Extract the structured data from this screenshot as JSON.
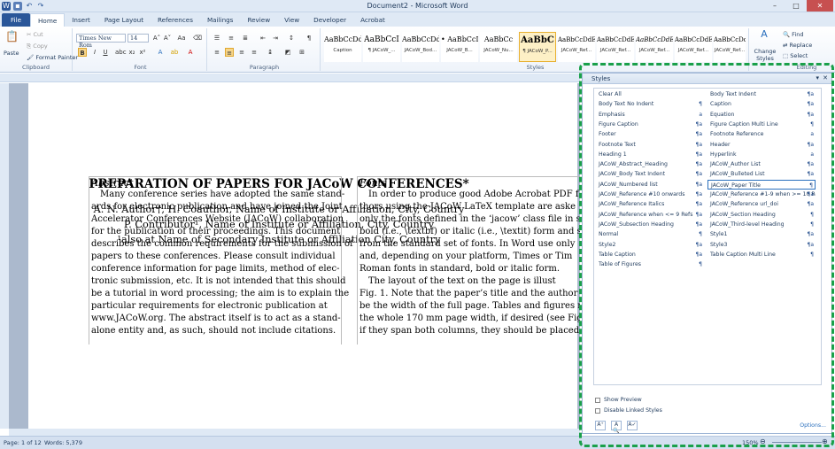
{
  "window": {
    "title": "Document2 - Microsoft Word",
    "qat_icons": [
      "word-icon",
      "save-icon",
      "undo-icon",
      "redo-icon"
    ]
  },
  "tabs": [
    "File",
    "Home",
    "Insert",
    "Page Layout",
    "References",
    "Mailings",
    "Review",
    "View",
    "Developer",
    "Acrobat"
  ],
  "ribbon": {
    "clipboard": {
      "label": "Clipboard",
      "paste": "Paste",
      "cut": "Cut",
      "copy": "Copy",
      "format_painter": "Format Painter"
    },
    "font": {
      "label": "Font",
      "font_name": "Times New Rom",
      "font_size": "14"
    },
    "paragraph": {
      "label": "Paragraph"
    },
    "styles": {
      "label": "Styles",
      "gallery": [
        {
          "preview": "AaBbCcDd",
          "name": "Caption"
        },
        {
          "preview": "AaBbCcI",
          "name": "¶ JACoW_..."
        },
        {
          "preview": "AaBbCcDd",
          "name": "JACoW_Bod..."
        },
        {
          "preview": "• AaBbCcI",
          "name": "JACoW_B..."
        },
        {
          "preview": "AaBbCc",
          "name": "JACoW_Nu..."
        },
        {
          "preview": "AaBbC",
          "name": "¶ JACoW_P..."
        },
        {
          "preview": "AaBbCcDdE",
          "name": "JACoW_Ref..."
        },
        {
          "preview": "AaBbCcDdE",
          "name": "JACoW_Ref..."
        },
        {
          "preview": "AaBbCcDdE",
          "name": "JACoW_Ref..."
        },
        {
          "preview": "AaBbCcDdE",
          "name": "JACoW_Ref..."
        },
        {
          "preview": "AaBbCcDdE",
          "name": "JACoW_Ref..."
        }
      ],
      "change_styles": "Change Styles"
    },
    "editing": {
      "label": "Editing",
      "find": "Find",
      "replace": "Replace",
      "select": "Select"
    }
  },
  "document": {
    "title": "PREPARATION OF PAPERS FOR JACoW CONFERENCES*",
    "authors": [
      "A. N. Author†, H. Coauthor, Name of Institute or Affiliation, City, Country",
      "P. Contributor¹, Name of Institute or Affiliation, City, Country",
      "¹also at Name of Secondary Institute or Affiliation City, Country"
    ],
    "abstract_heading": "Abstract",
    "abstract_lines": [
      "Many conference series have adopted the same stand-",
      "ards for electronic publication and have joined the Joint",
      "Accelerator Conferences Website (JACoW) collaboration",
      "for the publication of their proceedings. This document",
      "describes the common requirements for the submission of",
      "papers to these conferences. Please consult individual",
      "conference information for page limits, method of elec-",
      "tronic submission, etc. It is not intended that this should",
      "be a tutorial in word processing; the aim is to explain the",
      "particular requirements for electronic publication at",
      "www.JACoW.org. The abstract itself is to act as a stand-",
      "alone entity and, as such, should not include citations."
    ],
    "fonts_heading": "Fonts",
    "fonts_lines": [
      "In order to produce good Adobe Acrobat PDF f",
      "thors using the JACoW LaTeX template are aske",
      "only the fonts defined in the ‘jacow’ class file in s",
      "bold (i.e., \\textbf) or italic (i.e., \\textit) form and s",
      "from the standard set of fonts. In Word use only",
      "and, depending on your platform, Times or Tim",
      "Roman fonts in standard, bold or italic form.",
      "The layout of the text on the page is illust",
      "Fig. 1. Note that the paper’s title and the author lis",
      "be the width of the full page. Tables and figures m",
      "the whole 170 mm page width, if desired (see Fig",
      "if they span both columns, they should be placed"
    ]
  },
  "status": {
    "page": "Page: 1 of 12",
    "words": "Words: 5,379",
    "zoom": "150%"
  },
  "styles_panel": {
    "title": "Styles",
    "items_left": [
      {
        "name": "Clear All",
        "mark": ""
      },
      {
        "name": "Body Text No Indent",
        "mark": "¶"
      },
      {
        "name": "Emphasis",
        "mark": "a"
      },
      {
        "name": "Figure Caption",
        "mark": "¶a"
      },
      {
        "name": "Footer",
        "mark": "¶a"
      },
      {
        "name": "Footnote Text",
        "mark": "¶a"
      },
      {
        "name": "Heading 1",
        "mark": "¶a"
      },
      {
        "name": "JACoW_Abstract_Heading",
        "mark": "¶a"
      },
      {
        "name": "JACoW_Body Text Indent",
        "mark": "¶a"
      },
      {
        "name": "JACoW_Numbered list",
        "mark": "¶a"
      },
      {
        "name": "JACoW_Reference #10 onwards",
        "mark": "¶a"
      },
      {
        "name": "JACoW_Reference Italics",
        "mark": "¶a"
      },
      {
        "name": "JACoW_Reference when <= 9 Refs",
        "mark": "¶a"
      },
      {
        "name": "JACoW_Subsection Heading",
        "mark": "¶a"
      },
      {
        "name": "Normal",
        "mark": "¶"
      },
      {
        "name": "Style2",
        "mark": "¶a"
      },
      {
        "name": "Table Caption",
        "mark": "¶a"
      },
      {
        "name": "Table of Figures",
        "mark": "¶"
      }
    ],
    "items_right": [
      {
        "name": "Body Text Indent",
        "mark": "¶a"
      },
      {
        "name": "Caption",
        "mark": "¶a"
      },
      {
        "name": "Equation",
        "mark": "¶a"
      },
      {
        "name": "Figure Caption Multi Line",
        "mark": "¶"
      },
      {
        "name": "Footnote Reference",
        "mark": "a"
      },
      {
        "name": "Header",
        "mark": "¶a"
      },
      {
        "name": "Hyperlink",
        "mark": "a"
      },
      {
        "name": "JACoW_Author List",
        "mark": "¶a"
      },
      {
        "name": "JACoW_Bulleted List",
        "mark": "¶a"
      },
      {
        "name": "JACoW_Paper Title",
        "mark": "¶"
      },
      {
        "name": "JACoW_Reference #1-9 when >= 10 Refs",
        "mark": "¶a"
      },
      {
        "name": "JACoW_Reference url_doi",
        "mark": "¶a"
      },
      {
        "name": "JACoW_Section Heading",
        "mark": "¶"
      },
      {
        "name": "JACoW_Third-level Heading",
        "mark": "¶"
      },
      {
        "name": "Style1",
        "mark": "¶a"
      },
      {
        "name": "Style3",
        "mark": "¶a"
      },
      {
        "name": "Table Caption Multi Line",
        "mark": "¶"
      }
    ],
    "selected": "JACoW_Paper Title",
    "show_preview": "Show Preview",
    "disable_linked": "Disable Linked Styles",
    "options": "Options..."
  }
}
